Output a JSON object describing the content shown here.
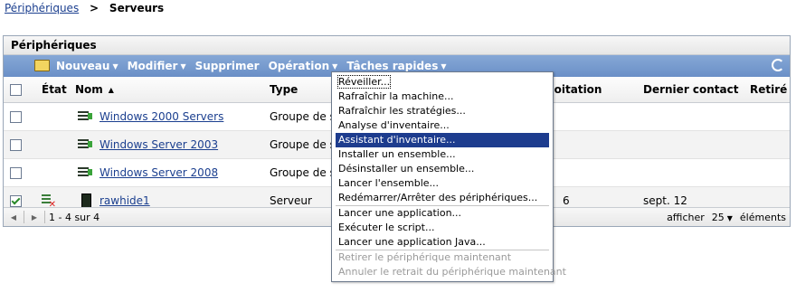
{
  "breadcrumb": {
    "parent": "Périphériques",
    "separator": ">",
    "current": "Serveurs"
  },
  "panel": {
    "title": "Périphériques"
  },
  "toolbar": {
    "items": [
      {
        "label": "Nouveau",
        "has_caret": true
      },
      {
        "label": "Modifier",
        "has_caret": true
      },
      {
        "label": "Supprimer",
        "has_caret": false
      },
      {
        "label": "Opération",
        "has_caret": true
      },
      {
        "label": "Tâches rapides",
        "has_caret": true
      }
    ],
    "caret": "▼"
  },
  "columns": {
    "etat": "État",
    "nom": "Nom",
    "sort_indicator": "▲",
    "type": "Type",
    "exploitation": "Exploitation",
    "dernier_contact": "Dernier contact",
    "retire": "Retiré"
  },
  "rows": [
    {
      "name": "Windows 2000 Servers",
      "type": "Groupe de s",
      "icon": "server-group-icon",
      "checked": false,
      "contact": "",
      "exploitation": ""
    },
    {
      "name": "Windows Server 2003",
      "type": "Groupe de s",
      "icon": "server-group-icon",
      "checked": false,
      "contact": "",
      "exploitation": ""
    },
    {
      "name": "Windows Server 2008",
      "type": "Groupe de s",
      "icon": "server-group-icon",
      "checked": false,
      "contact": "",
      "exploitation": ""
    },
    {
      "name": "rawhide1",
      "type": "Serveur",
      "icon": "server-icon",
      "checked": true,
      "contact": "sept. 12",
      "exploitation": "6"
    }
  ],
  "pager": {
    "prev": "◀",
    "next": "▶",
    "summary": "1 - 4 sur 4",
    "show_label": "afficher",
    "page_size": "25",
    "caret": "▼",
    "unit_label": "éléments"
  },
  "quick_tasks_menu": {
    "groups": [
      [
        {
          "label": "Réveiller...",
          "state": "focused"
        },
        {
          "label": "Rafraîchir la machine...",
          "state": "normal"
        },
        {
          "label": "Rafraîchir les stratégies...",
          "state": "normal"
        },
        {
          "label": "Analyse d'inventaire...",
          "state": "normal"
        },
        {
          "label": "Assistant d'inventaire...",
          "state": "selected"
        },
        {
          "label": "Installer un ensemble...",
          "state": "normal"
        },
        {
          "label": "Désinstaller un ensemble...",
          "state": "normal"
        },
        {
          "label": "Lancer l'ensemble...",
          "state": "normal"
        },
        {
          "label": "Redémarrer/Arrêter des périphériques...",
          "state": "normal"
        }
      ],
      [
        {
          "label": "Lancer une application...",
          "state": "normal"
        },
        {
          "label": "Exécuter le script...",
          "state": "normal"
        },
        {
          "label": "Lancer une application Java...",
          "state": "normal"
        }
      ],
      [
        {
          "label": "Retirer le périphérique maintenant",
          "state": "disabled"
        },
        {
          "label": "Annuler le retrait du périphérique maintenant",
          "state": "disabled"
        }
      ]
    ]
  },
  "colors": {
    "toolbar": "#7398cc",
    "link": "#1b3f8f",
    "menu_highlight": "#1d3c8e"
  }
}
